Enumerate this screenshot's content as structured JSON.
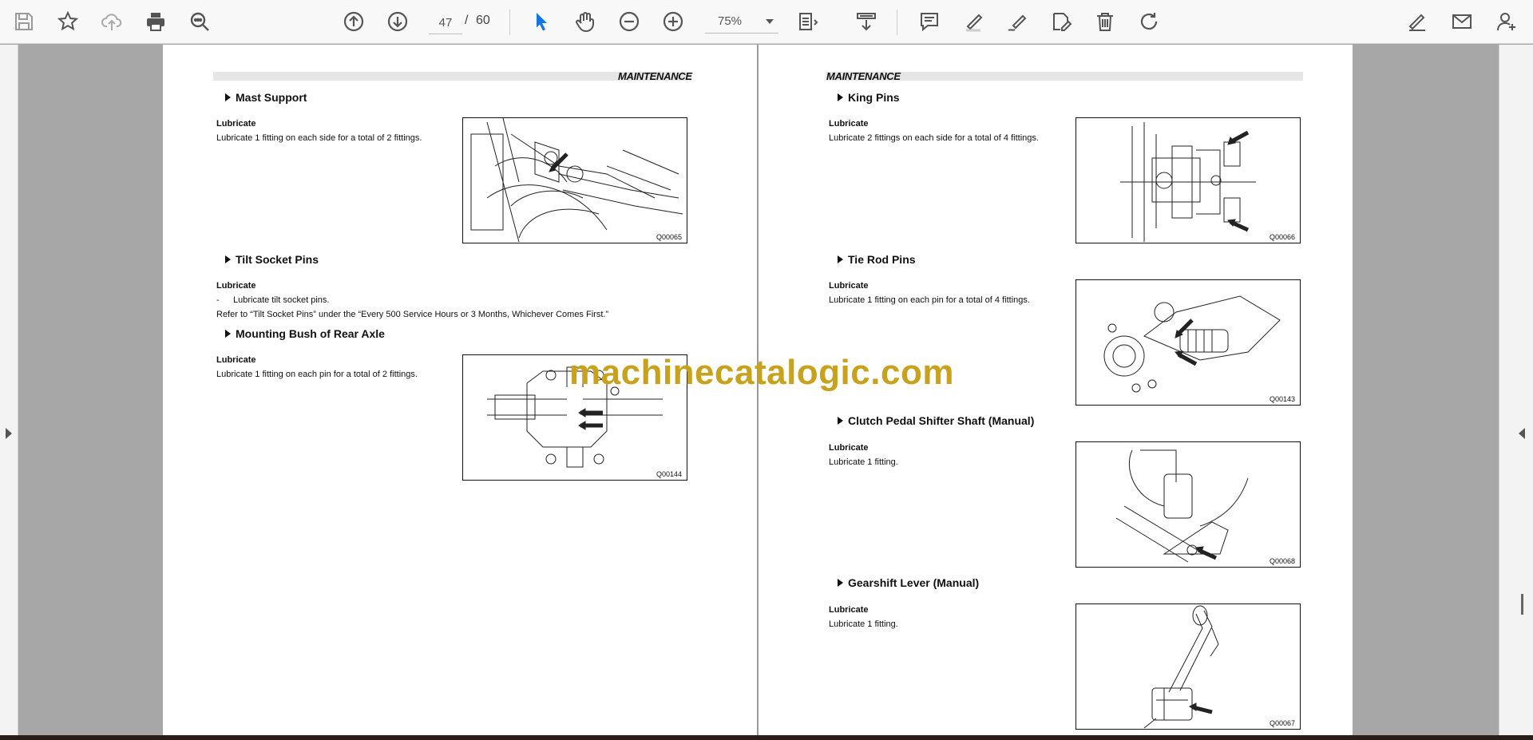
{
  "toolbar": {
    "page_current": "47",
    "page_sep": "/",
    "page_total": "60",
    "zoom": "75%"
  },
  "colors": {
    "accent": "#1473e6",
    "watermark": "#c8a21c"
  },
  "icons": [
    "save-icon",
    "bookmark-star-icon",
    "upload-cloud-icon",
    "print-icon",
    "zoom-search-icon",
    "page-up-icon",
    "page-down-icon",
    "select-cursor-icon",
    "hand-icon",
    "zoom-out-icon",
    "zoom-in-icon",
    "fit-page-icon",
    "scroll-mode-icon",
    "comment-icon",
    "highlight-icon",
    "draw-icon",
    "fill-sign-icon",
    "delete-icon",
    "rotate-icon",
    "sign-icon",
    "email-icon",
    "user-add-icon"
  ],
  "left_page": {
    "header": "MAINTENANCE",
    "sections": [
      {
        "title": "Mast Support",
        "label": "Lubricate",
        "text": "Lubricate 1 fitting on each side for a total of 2 fittings.",
        "figure": "Q00065"
      },
      {
        "title": "Tilt Socket Pins",
        "label": "Lubricate",
        "bullet_dash": "-",
        "bullet": "Lubricate tilt socket pins.",
        "text": "Refer to “Tilt Socket Pins” under the “Every 500 Service Hours or 3 Months, Whichever Comes First.”"
      },
      {
        "title": "Mounting Bush of Rear Axle",
        "label": "Lubricate",
        "text": "Lubricate 1 fitting on each pin for a total of 2 fittings.",
        "figure": "Q00144"
      }
    ]
  },
  "right_page": {
    "header": "MAINTENANCE",
    "sections": [
      {
        "title": "King Pins",
        "label": "Lubricate",
        "text": "Lubricate 2 fittings on each side for a total of 4 fittings.",
        "figure": "Q00066"
      },
      {
        "title": "Tie Rod Pins",
        "label": "Lubricate",
        "text": "Lubricate 1 fitting on each pin for a total of 4 fittings.",
        "figure": "Q00143"
      },
      {
        "title": "Clutch Pedal Shifter Shaft (Manual)",
        "label": "Lubricate",
        "text": "Lubricate 1 fitting.",
        "figure": "Q00068"
      },
      {
        "title": "Gearshift Lever (Manual)",
        "label": "Lubricate",
        "text": "Lubricate 1 fitting.",
        "figure": "Q00067"
      }
    ]
  },
  "watermark": "machinecatalogic.com"
}
